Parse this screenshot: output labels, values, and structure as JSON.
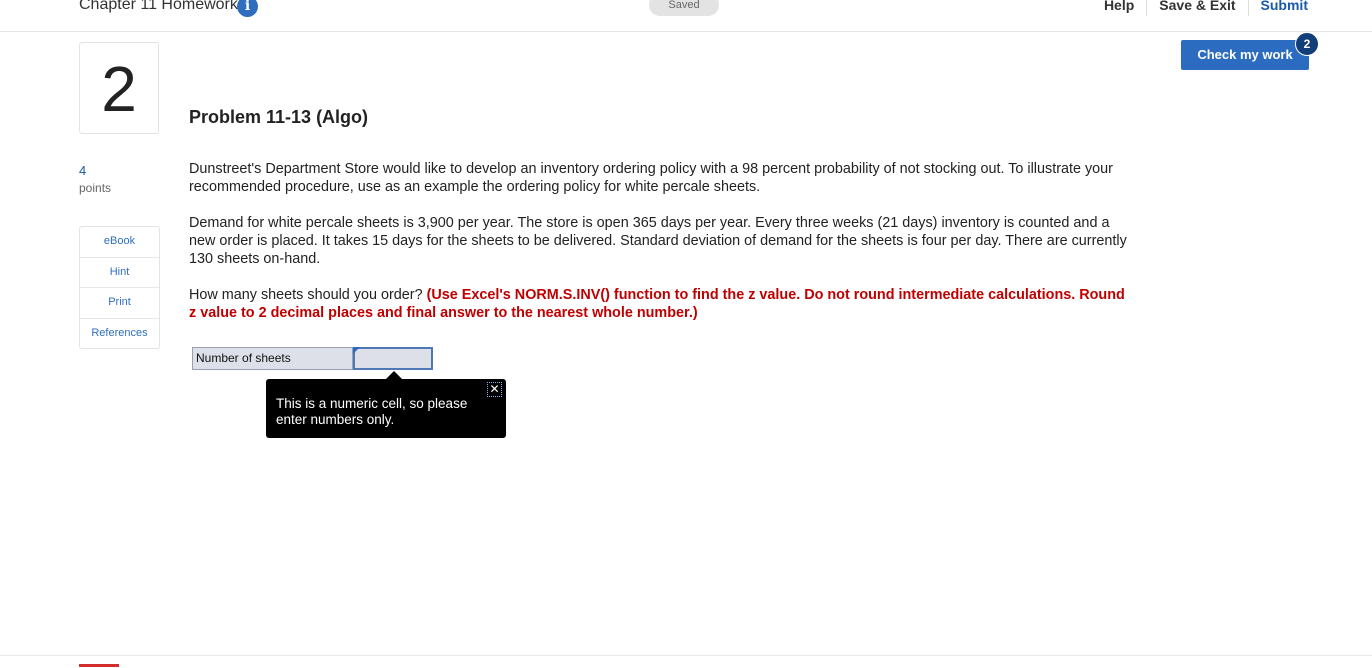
{
  "header": {
    "assignment_title": "Chapter 11 Homework",
    "info_icon": "info-icon",
    "saved_status": "Saved",
    "links": {
      "help": "Help",
      "save_exit": "Save & Exit",
      "submit": "Submit"
    }
  },
  "question": {
    "number": "2",
    "points_value": "4",
    "points_label": "points",
    "tools": {
      "ebook": "eBook",
      "hint": "Hint",
      "print": "Print",
      "references": "References"
    }
  },
  "check_work": {
    "label": "Check my work",
    "badge_count": "2"
  },
  "problem": {
    "title": "Problem 11-13 (Algo)",
    "paragraph1": "Dunstreet's Department Store would like to develop an inventory ordering policy with a 98 percent probability of not stocking out. To illustrate your recommended procedure, use as an example the ordering policy for white percale sheets.",
    "paragraph2": "Demand for white percale sheets is 3,900 per year. The store is open 365 days per year. Every three weeks (21 days) inventory is counted and a new order is placed. It takes 15 days for the sheets to be delivered. Standard deviation of demand for the sheets is four per day. There are currently 130 sheets on-hand.",
    "question_text": "How many sheets should you order?",
    "instructions": "(Use Excel's NORM.S.INV() function to find the z value. Do not round intermediate calculations. Round z value to 2 decimal places and final answer to the nearest whole number.)"
  },
  "answer": {
    "label": "Number of sheets",
    "value": ""
  },
  "tooltip": {
    "message": "This is a numeric cell, so please enter numbers only.",
    "close_glyph": "✕"
  }
}
